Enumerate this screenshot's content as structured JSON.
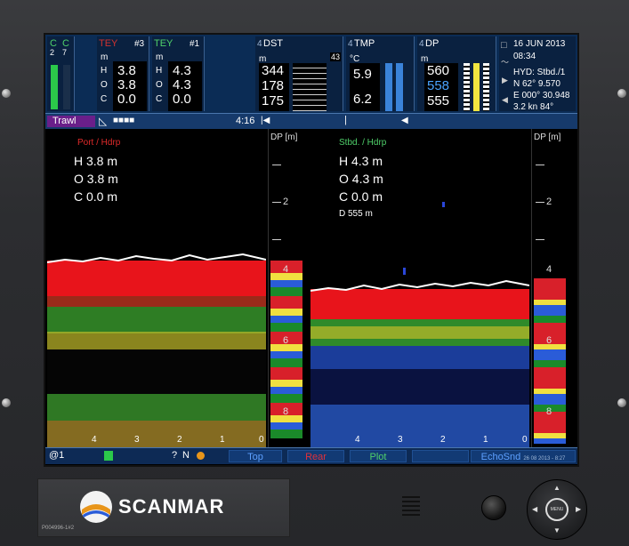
{
  "top": {
    "c1": {
      "label": "C",
      "value": "2"
    },
    "c2": {
      "label": "C",
      "value": "7"
    },
    "tey3": {
      "title": "TEY",
      "num": "#3",
      "unit": "m",
      "h_label": "H",
      "h": "3.8",
      "o_label": "O",
      "o": "3.8",
      "c_label": "C",
      "c": "0.0"
    },
    "tey1": {
      "title": "TEY",
      "num": "#1",
      "unit": "m",
      "h_label": "H",
      "h": "4.3",
      "o_label": "O",
      "o": "4.3",
      "c_label": "C",
      "c": "0.0"
    },
    "dst": {
      "prefix": "4",
      "title": "DST",
      "unit": "m",
      "values": [
        "344",
        "178",
        "175"
      ],
      "badge": "43"
    },
    "tmp": {
      "prefix": "4",
      "title": "TMP",
      "unit": "°C",
      "values": [
        "5.9",
        "6.2"
      ]
    },
    "dp": {
      "prefix": "4",
      "title": "DP",
      "unit": "m",
      "values": [
        "560",
        "558",
        "555"
      ]
    },
    "info": {
      "date": "16 JUN 2013",
      "time": "08:34",
      "hyd": "HYD: Stbd./1",
      "lat": "N  62° 9.570",
      "lon": "E 000° 30.948",
      "speed": "3.2 kn   84°"
    }
  },
  "trawlbar": {
    "label": "Trawl",
    "time": "4:16"
  },
  "port": {
    "title": "Port / Hdrp",
    "h": "H  3.8 m",
    "o": "O  3.8 m",
    "c": "C  0.0 m"
  },
  "stbd": {
    "title": "Stbd. / Hdrp",
    "h": "H  4.3 m",
    "o": "O  4.3 m",
    "c": "C  0.0 m",
    "d": "D  555 m"
  },
  "scale_left": {
    "label": "DP [m]",
    "ticks": [
      "2",
      "4",
      "6",
      "8"
    ]
  },
  "scale_right": {
    "label": "DP [m]",
    "ticks": [
      "2",
      "4",
      "6",
      "8"
    ]
  },
  "bottom_axis_left": [
    "4",
    "3",
    "2",
    "1",
    "0"
  ],
  "bottom_axis_right": [
    "4",
    "3",
    "2",
    "1",
    "0"
  ],
  "bottombar": {
    "page": "@1",
    "help": "?",
    "north": "N",
    "top": "Top",
    "rear": "Rear",
    "plot": "Plot",
    "echosnd": "EchoSnd",
    "stamp": "26 08 2013 - 8:27"
  },
  "device": {
    "brand": "SCANMAR",
    "code": "P004996-1#2"
  },
  "dpad": {
    "center": "MENU"
  }
}
